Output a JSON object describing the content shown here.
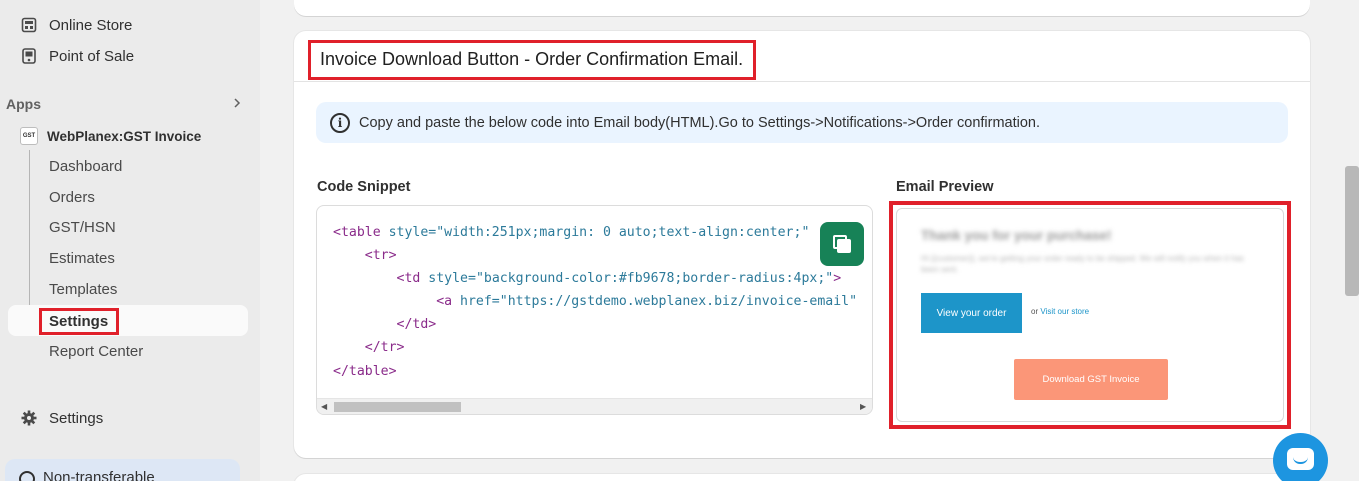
{
  "sidebar": {
    "online_store": "Online Store",
    "point_of_sale": "Point of Sale",
    "apps_label": "Apps",
    "app_icon_text": "GST",
    "app_name": "WebPlanex:GST Invoice",
    "sub_items": [
      "Dashboard",
      "Orders",
      "GST/HSN",
      "Estimates",
      "Templates"
    ],
    "active_item": "Settings",
    "report_center": "Report Center",
    "settings": "Settings",
    "non_transferable": "Non-transferable"
  },
  "card": {
    "title": "Invoice Download Button - Order Confirmation Email.",
    "info_text": "Copy and paste the below code into Email body(HTML).Go to Settings->Notifications->Order confirmation.",
    "code_label": "Code Snippet",
    "preview_label": "Email Preview"
  },
  "code_lines": {
    "l1_tag": "<table",
    "l1_attr": " style=",
    "l1_str": "\"width:251px;margin: 0 auto;text-align:center;\"",
    "l2": "<tr>",
    "l3_tag": "<td",
    "l3_attr": " style=",
    "l3_str": "\"background-color:#fb9678;border-radius:4px;\"",
    "l3_end": ">",
    "l4_tag": "<a",
    "l4_attr": " href=",
    "l4_str": "\"https://gstdemo.webplanex.biz/invoice-email\"",
    "l5": "</td>",
    "l6": "</tr>",
    "l7": "</table>"
  },
  "preview": {
    "heading": "Thank you for your purchase!",
    "subtext": "Hi {{customer}}, we're getting your order ready to be shipped. We will notify you when it has been sent.",
    "view_order": "View your order",
    "or_text": "or",
    "visit_store": "Visit our store",
    "download_button": "Download GST Invoice"
  },
  "colors": {
    "highlight": "#e0202a",
    "copy_button": "#178257",
    "preview_primary": "#1d95c9",
    "download_button": "#fb9678",
    "info_banner": "#eaf4ff",
    "chat": "#1d95e0"
  }
}
